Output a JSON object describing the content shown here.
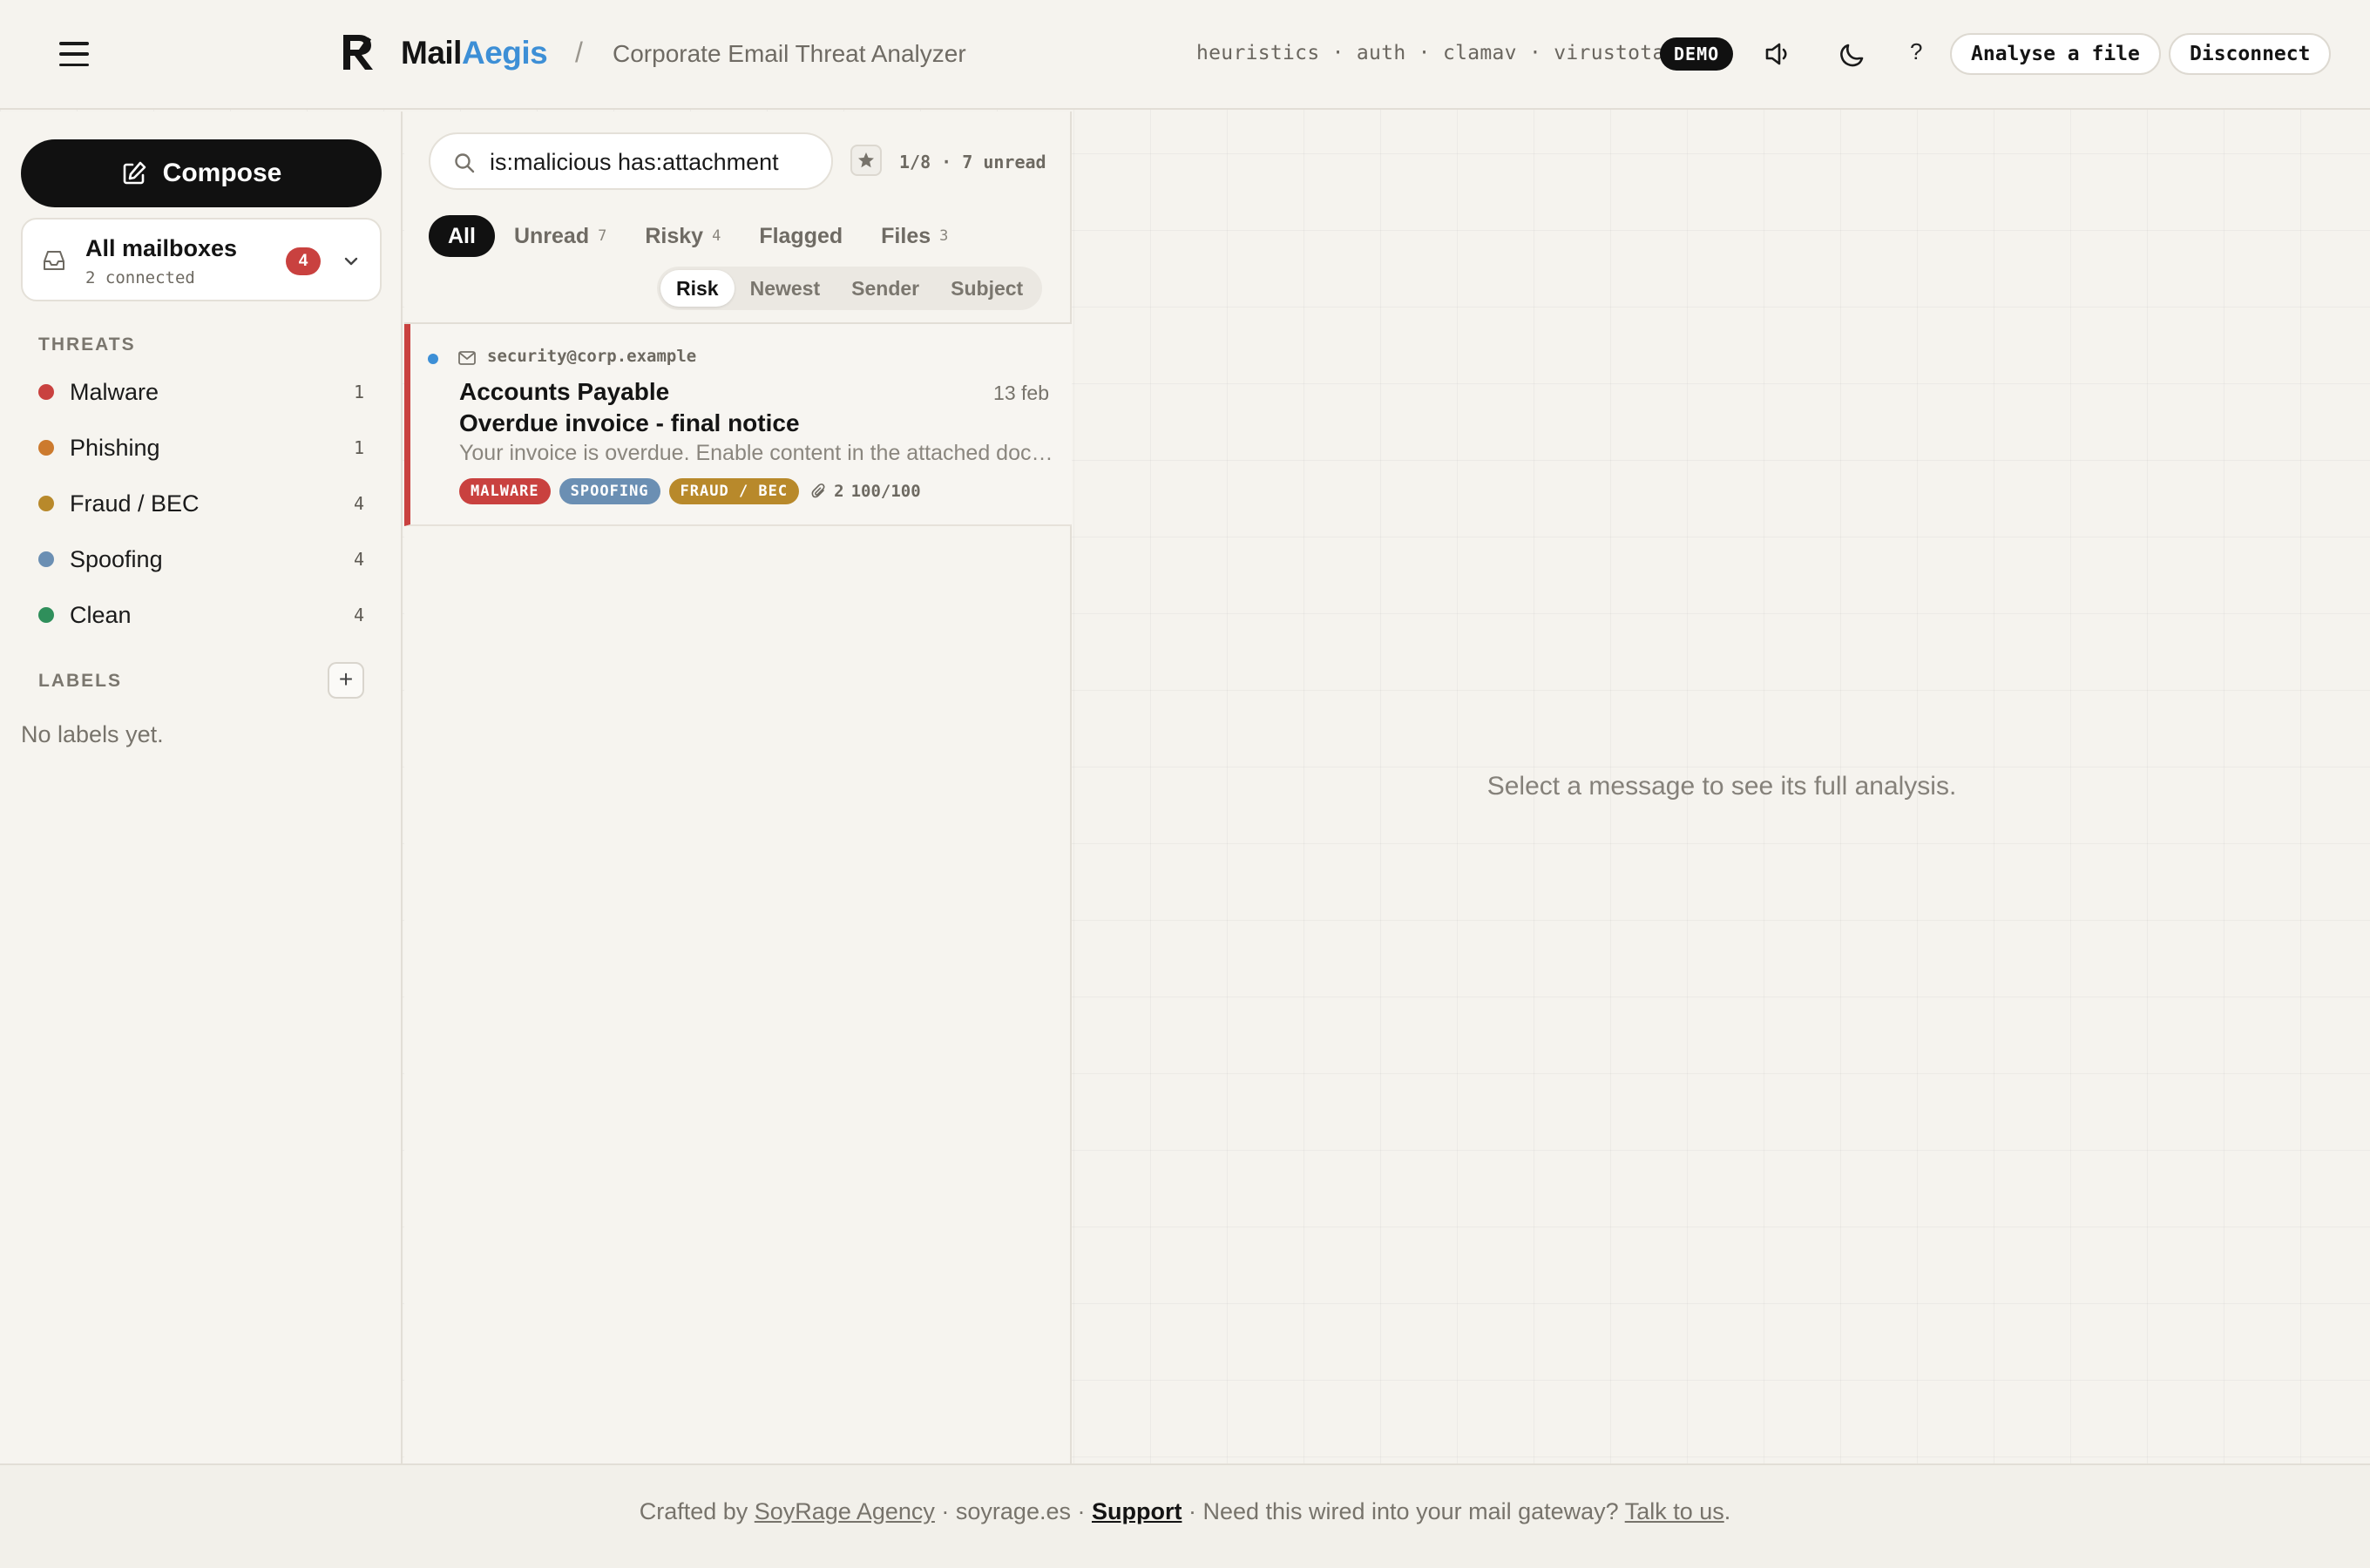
{
  "header": {
    "brand_part1": "Mail",
    "brand_part2": "Aegis",
    "separator": "/",
    "subtitle": "Corporate Email Threat Analyzer",
    "engines": "heuristics · auth · clamav · virustotal",
    "mode_badge": "DEMO",
    "help_label": "?",
    "analyse_button": "Analyse a file",
    "disconnect_button": "Disconnect",
    "icons": [
      "menu-icon",
      "brand-logo-icon",
      "volume-icon",
      "moon-icon"
    ]
  },
  "sidebar": {
    "compose_label": "Compose",
    "mailbox": {
      "title": "All mailboxes",
      "subtitle": "2 connected",
      "count": "4"
    },
    "threats_title": "THREATS",
    "threats": [
      {
        "label": "Malware",
        "count": "1",
        "color": "#c9413f"
      },
      {
        "label": "Phishing",
        "count": "1",
        "color": "#cc7a2e"
      },
      {
        "label": "Fraud / BEC",
        "count": "4",
        "color": "#b8892b"
      },
      {
        "label": "Spoofing",
        "count": "4",
        "color": "#6b8fb3"
      },
      {
        "label": "Clean",
        "count": "4",
        "color": "#2f8f5b"
      }
    ],
    "labels_title": "LABELS",
    "add_label": "+",
    "no_labels": "No labels yet."
  },
  "list": {
    "search_value": "is:malicious has:attachment",
    "list_meta": "1/8 · 7 unread",
    "filter_tabs": [
      {
        "label": "All",
        "count": ""
      },
      {
        "label": "Unread",
        "count": "7"
      },
      {
        "label": "Risky",
        "count": "4"
      },
      {
        "label": "Flagged",
        "count": ""
      },
      {
        "label": "Files",
        "count": "3"
      }
    ],
    "sort_options": [
      "Risk",
      "Newest",
      "Sender",
      "Subject"
    ],
    "messages": [
      {
        "from_address": "security@corp.example",
        "sender": "Accounts Payable",
        "date": "13 feb",
        "subject": "Overdue invoice - final notice",
        "preview": "Your invoice is overdue. Enable content in the attached document to view the payment details.",
        "tags": [
          {
            "label": "MALWARE",
            "color": "#c9413f"
          },
          {
            "label": "SPOOFING",
            "color": "#6b8fb3"
          },
          {
            "label": "FRAUD / BEC",
            "color": "#b8892b"
          }
        ],
        "attachments": "2",
        "score": "100/100",
        "risk_color": "#c9413f"
      }
    ]
  },
  "detail": {
    "empty_text": "Select a message to see its full analysis."
  },
  "footer": {
    "crafted_by": "Crafted by ",
    "agency": "SoyRage Agency",
    "mid1": " · soyrage.es · ",
    "support": "Support",
    "mid2": " · Need this wired into your mail gateway? ",
    "talk": "Talk to us",
    "end": "."
  }
}
